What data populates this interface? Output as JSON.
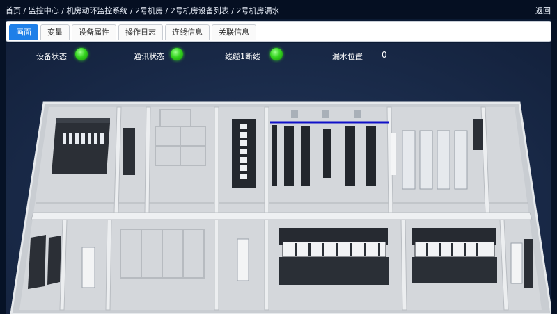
{
  "breadcrumb": [
    "首页",
    "监控中心",
    "机房动环监控系统",
    "2号机房",
    "2号机房设备列表",
    "2号机房漏水"
  ],
  "separator": " / ",
  "back_label": "返回",
  "tabs": [
    {
      "label": "画面",
      "active": true
    },
    {
      "label": "变量",
      "active": false
    },
    {
      "label": "设备属性",
      "active": false
    },
    {
      "label": "操作日志",
      "active": false
    },
    {
      "label": "连线信息",
      "active": false
    },
    {
      "label": "关联信息",
      "active": false
    }
  ],
  "status": {
    "device_label": "设备状态",
    "comm_label": "通讯状态",
    "cable_label": "线缆1断线",
    "leak_label": "漏水位置",
    "leak_value": "0",
    "led_color": "#34d41f"
  },
  "colors": {
    "active_tab": "#1e7fe8",
    "leak_cable": "#1010c8"
  }
}
